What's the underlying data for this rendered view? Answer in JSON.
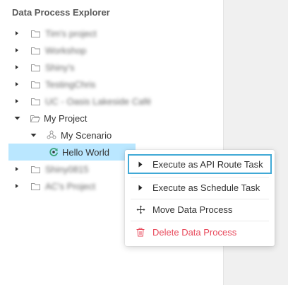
{
  "panel": {
    "title": "Data Process Explorer"
  },
  "tree": {
    "projects_top": [
      {
        "label": "Tim's project",
        "blurred": true
      },
      {
        "label": "Workshop",
        "blurred": true
      },
      {
        "label": "Shiny's",
        "blurred": true
      },
      {
        "label": "TestingChris",
        "blurred": true
      },
      {
        "label": "UC - Oasis Lakeside Café",
        "blurred": true
      }
    ],
    "my_project": {
      "label": "My Project"
    },
    "scenario": {
      "label": "My Scenario"
    },
    "process": {
      "label": "Hello World"
    },
    "projects_bottom": [
      {
        "label": "Shiny0815",
        "blurred": true
      },
      {
        "label": "AC's Project",
        "blurred": true
      }
    ]
  },
  "context_menu": {
    "execute_api": "Execute as API Route Task",
    "execute_schedule": "Execute as Schedule Task",
    "move": "Move Data Process",
    "delete": "Delete Data Process"
  },
  "colors": {
    "selected_row": "#bae7ff",
    "highlight_border": "#40a9d6",
    "danger": "#e8495b",
    "process_icon": "#3aa37a"
  }
}
